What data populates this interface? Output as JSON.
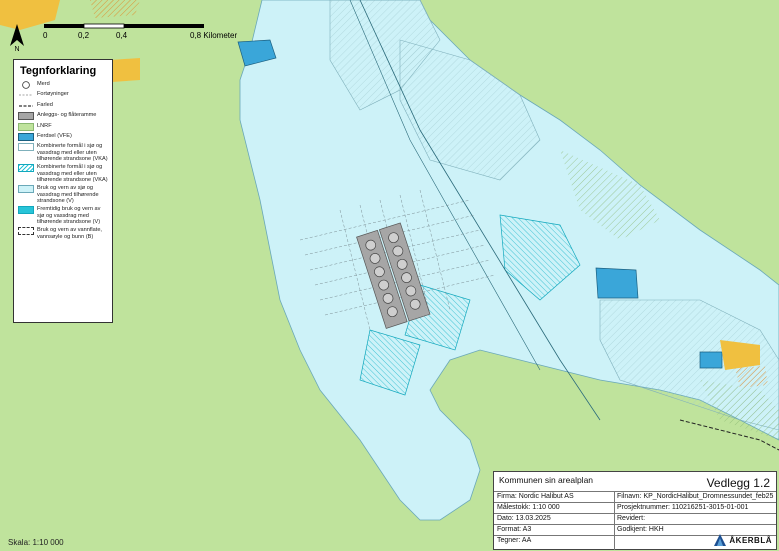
{
  "legend": {
    "title": "Tegnforklaring",
    "items": [
      {
        "id": "merd",
        "label": "Merd"
      },
      {
        "id": "fortoyninger",
        "label": "Fortøyninger"
      },
      {
        "id": "farled",
        "label": "Farled"
      },
      {
        "id": "anlegg",
        "label": "Anleggs- og flåteramme"
      },
      {
        "id": "lnrf",
        "label": "LNRF"
      },
      {
        "id": "ferdsel",
        "label": "Ferdsel (VFE)"
      },
      {
        "id": "vka1",
        "label": "Kombinerte formål i sjø og vassdrag med eller uten tilhørende strandsone (VKA)"
      },
      {
        "id": "vka2",
        "label": "Kombinerte formål i sjø og vassdrag med eller uten tilhørende strandsone (VKA)"
      },
      {
        "id": "v1",
        "label": "Bruk og vern av sjø og vassdrag med tilhørende strandsone (V)"
      },
      {
        "id": "v2",
        "label": "Fremtidig bruk og vern av sjø og vassdrag med tilhørende strandsone (V)"
      },
      {
        "id": "b",
        "label": "Bruk og vern av vannflate, vannsøyle og bunn (B)"
      }
    ]
  },
  "scale": {
    "ticks": [
      "0",
      "0,2",
      "0,4",
      "0,8 Kilometer"
    ],
    "skala": "Skala: 1:10 000"
  },
  "titleblock": {
    "title": "Kommunen sin arealplan",
    "vedlegg": "Vedlegg 1.2",
    "firma": "Firma: Nordic Halibut AS",
    "filnavn": "Filnavn: KP_NordicHalibut_Dromnessundet_feb25",
    "malestokk": "Målestokk: 1:10 000",
    "prosjektnummer": "Prosjektnummer: 110216251-3015-01-001",
    "dato": "Dato: 13.03.2025",
    "revidert": "Revidert:",
    "format": "Format: A3",
    "godkjent": "Godkjent: HKH",
    "tegner": "Tegner: AA",
    "logo": "ÅKERBLÅ"
  },
  "colors": {
    "land": "#bfe39c",
    "sea": "#cdf2f8",
    "vfe": "#3aa6d9",
    "hatch_cyan": "#27c4d8",
    "anlegg": "#a6a6a6",
    "settlement": "#f0c040"
  }
}
